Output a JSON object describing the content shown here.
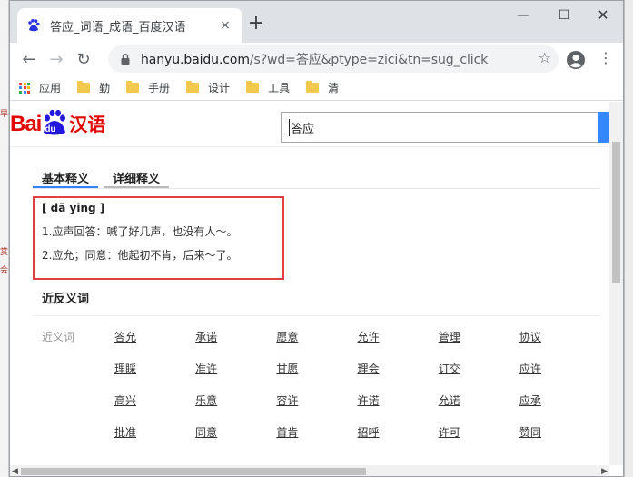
{
  "browser": {
    "tab_title": "答应_词语_成语_百度汉语",
    "tab_close": "×",
    "new_tab": "+",
    "window_minimize": "—",
    "window_maximize": "☐",
    "window_close": "✕",
    "back": "←",
    "forward": "→",
    "reload": "↻",
    "url_host": "hanyu.baidu.com",
    "url_rest": "/s?wd=答应&ptype=zici&tn=sug_click",
    "bookmark_star": "☆",
    "menu": "⋮"
  },
  "bookmarks": {
    "apps_label": "应用",
    "items": [
      "勤",
      "手册",
      "设计",
      "工具",
      "清"
    ]
  },
  "page": {
    "logo_bai": "Bai",
    "logo_du": "du",
    "logo_cn": "汉语",
    "search_value": "答应",
    "tabs": [
      "基本释义",
      "详细释义"
    ],
    "pinyin": "[ dā ying ]",
    "definitions": [
      "1.应声回答：喊了好几声，也没有人～。",
      "2.应允；同意：他起初不肯，后来～了。"
    ],
    "synonym_section_title": "近反义词",
    "synonym_label": "近义词",
    "synonyms": [
      [
        "答允",
        "承诺",
        "愿意",
        "允许",
        "管理",
        "协议"
      ],
      [
        "理睬",
        "准许",
        "甘愿",
        "理会",
        "订交",
        "应许"
      ],
      [
        "高兴",
        "乐意",
        "容许",
        "许诺",
        "允诺",
        "应承"
      ],
      [
        "批准",
        "同意",
        "首肯",
        "招呼",
        "许可",
        "赞同"
      ]
    ]
  },
  "colors": {
    "baidu_red": "#e10602",
    "baidu_blue": "#3385ff",
    "highlight_red": "#e04040"
  }
}
